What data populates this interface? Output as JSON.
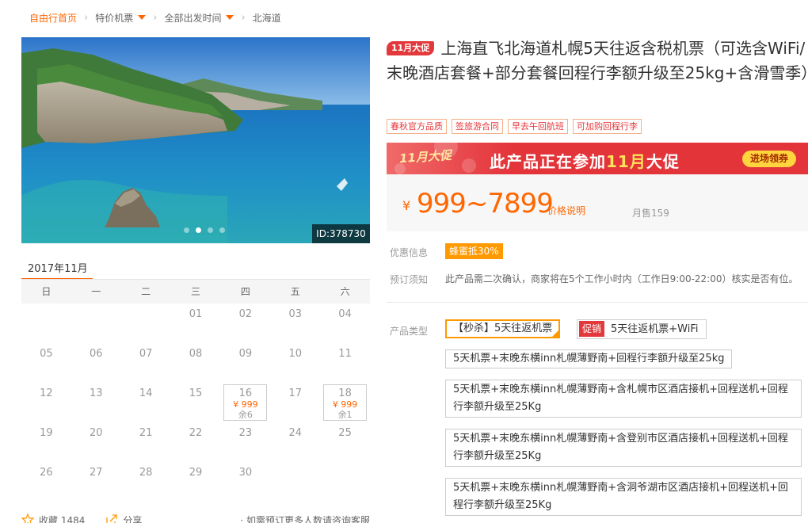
{
  "breadcrumb": {
    "home": "自由行首页",
    "items": [
      "特价机票",
      "全部出发时间",
      "北海道"
    ]
  },
  "hero": {
    "id_label": "ID:378730",
    "dot_count": 4,
    "active_dot": 1
  },
  "calendar": {
    "month": "2017年11月",
    "weekdays": [
      "日",
      "一",
      "二",
      "三",
      "四",
      "五",
      "六"
    ],
    "leading_blanks": 3,
    "days": [
      "01",
      "02",
      "03",
      "04",
      "05",
      "06",
      "07",
      "08",
      "09",
      "10",
      "11",
      "12",
      "13",
      "14",
      "15",
      "16",
      "17",
      "18",
      "19",
      "20",
      "21",
      "22",
      "23",
      "24",
      "25",
      "26",
      "27",
      "28",
      "29",
      "30"
    ],
    "available": {
      "16": {
        "price": "¥ 999",
        "stock": "余6"
      },
      "18": {
        "price": "¥ 999",
        "stock": "余1"
      }
    }
  },
  "footer": {
    "fav_label": "收藏 1484",
    "share_label": "分享",
    "note": "· 如需预订更多人数请咨询客服"
  },
  "product": {
    "promo_tag": "11月大促",
    "title": "上海直飞北海道札幌5天往返含税机票（可选含WiFi/末晚酒店套餐+部分套餐回程行李额升级至25kg+含滑雪季）",
    "tags": [
      "春秋官方品质",
      "签旅游合同",
      "早去午回航班",
      "可加购回程行李"
    ]
  },
  "banner": {
    "logo": "11月大促",
    "text_before": "此产品正在参加",
    "text_highlight": "11月",
    "text_after": "大促",
    "button": "进场领券"
  },
  "price": {
    "currency": "¥",
    "range": "999~7899",
    "explain": "价格说明",
    "sales": "月售159"
  },
  "info": {
    "discount_label": "优惠信息",
    "discount_tag": "蜂蜜抵30%",
    "notice_label": "预订须知",
    "notice": "此产品需二次确认，商家将在5个工作小时内（工作日9:00-22:00）核实是否有位。",
    "type_label": "产品类型"
  },
  "options": [
    {
      "label": "【秒杀】5天往返机票",
      "active": true
    },
    {
      "badge": "促销",
      "label": "5天往返机票+WiFi"
    },
    {
      "label": "5天机票+末晚东横inn札幌薄野南+回程行李额升级至25kg"
    },
    {
      "label": "5天机票+末晚东横inn札幌薄野南+含札幌市区酒店接机+回程送机+回程行李额升级至25Kg"
    },
    {
      "label": "5天机票+末晚东横inn札幌薄野南+含登别市区酒店接机+回程送机+回程行李额升级至25Kg"
    },
    {
      "label": "5天机票+末晚东横inn札幌薄野南+含洞爷湖市区酒店接机+回程送机+回程行李额升级至25Kg"
    }
  ]
}
